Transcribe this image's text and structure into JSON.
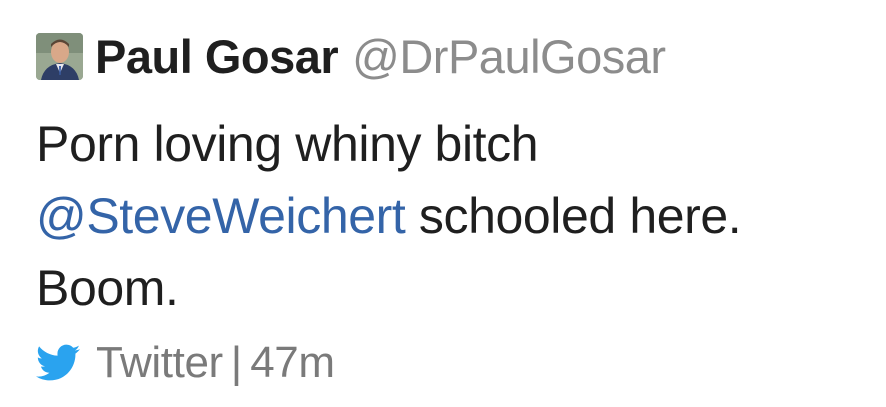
{
  "tweet": {
    "author": {
      "display_name": "Paul Gosar",
      "handle": "@DrPaulGosar",
      "avatar": "profile-photo"
    },
    "text": {
      "line1": "Porn loving whiny bitch",
      "mention": "@SteveWeichert",
      "after_mention": " schooled here.",
      "line3": "Boom."
    },
    "footer": {
      "icon": "twitter-bird-icon",
      "source": "Twitter",
      "separator": "|",
      "time": "47m"
    }
  },
  "colors": {
    "text": "#1f1f1f",
    "handle": "#8c8c8c",
    "mention": "#3464a8",
    "footer": "#7a7a7a",
    "twitter_blue": "#2aa3ef"
  }
}
